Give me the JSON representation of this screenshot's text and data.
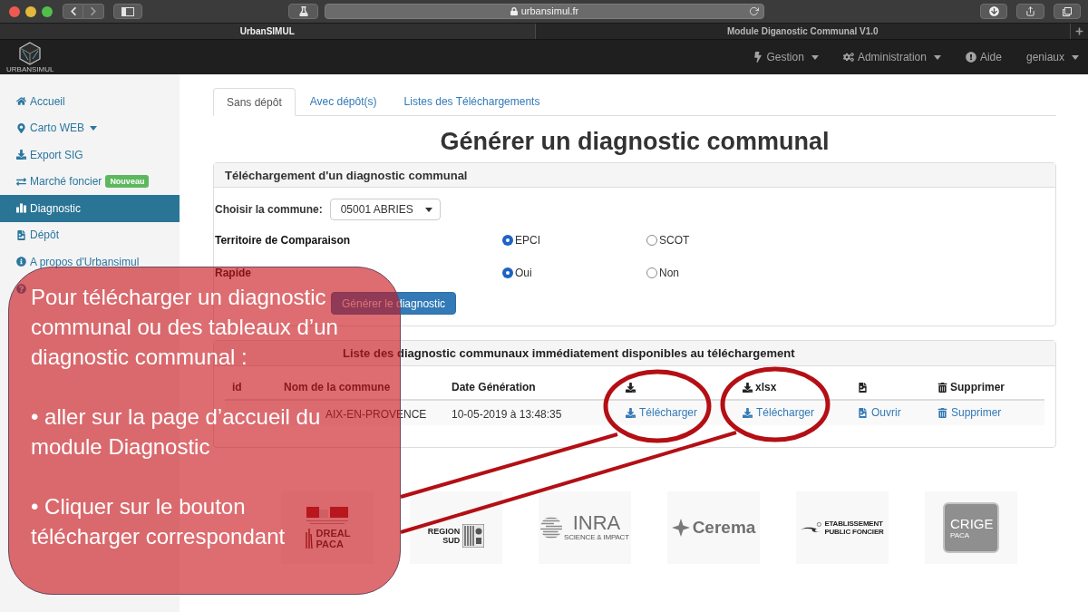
{
  "browser": {
    "address": "urbansimul.fr",
    "tabs": [
      {
        "title": "UrbanSIMUL",
        "selected": true
      },
      {
        "title": "Module Diganostic Communal V1.0",
        "selected": false
      }
    ]
  },
  "navbar": {
    "brand": "URBANSIMUL",
    "items": [
      {
        "label": "Gestion",
        "dropdown": true
      },
      {
        "label": "Administration",
        "dropdown": true
      },
      {
        "label": "Aide",
        "dropdown": false
      },
      {
        "label": "geniaux",
        "dropdown": true
      }
    ]
  },
  "sidebar": {
    "items": [
      {
        "label": "Accueil",
        "dropdown": false,
        "selected": false
      },
      {
        "label": "Carto WEB",
        "dropdown": true,
        "selected": false
      },
      {
        "label": "Export SIG",
        "dropdown": false,
        "selected": false
      },
      {
        "label": "Marché foncier",
        "badge": "Nouveau",
        "dropdown": false,
        "selected": false
      },
      {
        "label": "Diagnostic",
        "dropdown": false,
        "selected": true
      },
      {
        "label": "Dépôt",
        "dropdown": false,
        "selected": false
      },
      {
        "label": "A propos d'Urbansimul",
        "dropdown": false,
        "selected": false
      },
      {
        "selected": false
      }
    ]
  },
  "tabs": [
    {
      "label": "Sans dépôt",
      "selected": true
    },
    {
      "label": "Avec dépôt(s)",
      "selected": false
    },
    {
      "label": "Listes des Téléchargements",
      "selected": false
    }
  ],
  "title": "Générer un diagnostic communal",
  "form_panel": {
    "title": "Téléchargement d'un diagnostic communal",
    "commune_label": "Choisir la commune:",
    "commune_value": "05001 ABRIES",
    "radio_groups": [
      {
        "label": "Territoire de Comparaison",
        "options": [
          {
            "label": "EPCI",
            "selected": true
          },
          {
            "label": "SCOT",
            "selected": false
          }
        ]
      },
      {
        "label": "Rapide",
        "options": [
          {
            "label": "Oui",
            "selected": true
          },
          {
            "label": "Non",
            "selected": false
          }
        ]
      }
    ],
    "submit": "Générer le diagnostic"
  },
  "list_panel": {
    "title": "Liste des diagnostic communaux immédiatement disponibles au téléchargement",
    "columns": [
      {
        "kind": "text",
        "label": "id"
      },
      {
        "kind": "text",
        "label": "Nom de la commune"
      },
      {
        "kind": "text",
        "label": "Date Génération"
      },
      {
        "kind": "download"
      },
      {
        "kind": "download",
        "label": "xlsx"
      },
      {
        "kind": "open"
      },
      {
        "kind": "delete",
        "label": "Supprimer"
      }
    ],
    "rows": [
      {
        "cells": [
          {
            "kind": "text",
            "text": ""
          },
          {
            "kind": "text",
            "text": "AIX-EN-PROVENCE"
          },
          {
            "kind": "text",
            "text": "10-05-2019 à 13:48:35"
          },
          {
            "kind": "download",
            "text": "Télécharger"
          },
          {
            "kind": "download",
            "text": "Télécharger"
          },
          {
            "kind": "open",
            "text": "Ouvrir"
          },
          {
            "kind": "delete",
            "text": "Supprimer"
          }
        ]
      }
    ]
  },
  "logos": [
    {
      "kind": "dreal",
      "texts": [
        "DREAL",
        "PACA"
      ]
    },
    {
      "kind": "region",
      "texts": [
        "REGION",
        "SUD"
      ]
    },
    {
      "kind": "inra",
      "texts": [
        "INRA",
        "SCIENCE & IMPACT"
      ]
    },
    {
      "kind": "cerema",
      "texts": [
        "Cerema"
      ]
    },
    {
      "kind": "epf",
      "texts": [
        "ETABLISSEMENT",
        "PUBLIC FONCIER"
      ]
    },
    {
      "kind": "crige",
      "texts": [
        "CRIGE",
        "PACA"
      ]
    }
  ],
  "callout": {
    "paragraphs": [
      "Pour télécharger un diagnostic\ncommunal ou des tableaux d’un\ndiagnostic communal :",
      "• aller sur la page d’accueil du\nmodule Diagnostic",
      "• Cliquer sur le bouton\ntélécharger correspondant"
    ]
  }
}
